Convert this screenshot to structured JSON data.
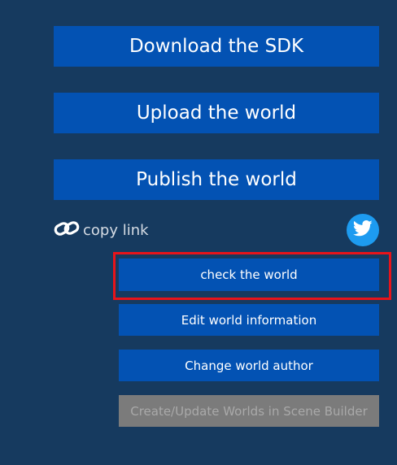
{
  "buttons": {
    "download_sdk": "Download the SDK",
    "upload_world": "Upload the world",
    "publish_world": "Publish the world",
    "check_world": "check the world",
    "edit_info": "Edit world information",
    "change_author": "Change world author",
    "scene_builder": "Create/Update Worlds in Scene Builder"
  },
  "copy_link": {
    "label": "copy link",
    "icon": "link-icon"
  },
  "share": {
    "icon": "twitter-icon"
  },
  "state": {
    "scene_builder_disabled": true,
    "highlighted_button": "check_world"
  },
  "colors": {
    "background": "#163a5f",
    "button": "#0352b3",
    "disabled_button": "#7b7b7b",
    "highlight_border": "#e8141a",
    "twitter": "#1d9bf0"
  }
}
